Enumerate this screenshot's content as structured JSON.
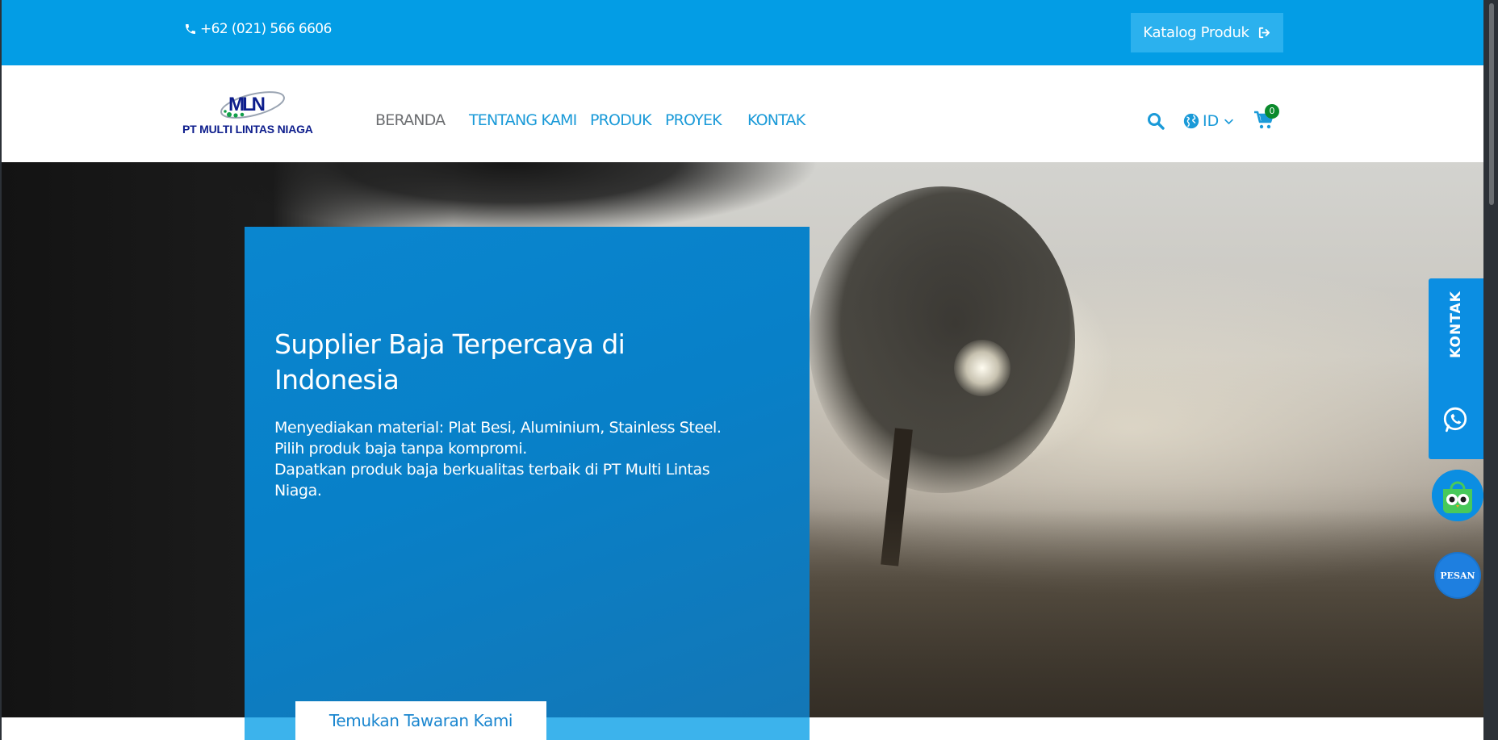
{
  "topbar": {
    "phone": "+62 (021) 566 6606",
    "catalog_label": "Katalog Produk"
  },
  "logo": {
    "mark": "MLN",
    "company_name": "PT MULTI LINTAS NIAGA"
  },
  "nav": {
    "items": [
      {
        "label": "BERANDA",
        "active": true
      },
      {
        "label": "TENTANG KAMI",
        "active": false
      },
      {
        "label": "PRODUK",
        "active": false
      },
      {
        "label": "PROYEK",
        "active": false
      },
      {
        "label": "KONTAK",
        "active": false
      }
    ],
    "language": "ID",
    "cart_count": "0"
  },
  "hero": {
    "title": "Supplier Baja Terpercaya di Indonesia",
    "description_lines": [
      "Menyediakan material: Plat Besi, Aluminium, Stainless Steel.",
      "Pilih produk baja tanpa kompromi.",
      "Dapatkan produk baja berkualitas terbaik di PT Multi Lintas Niaga."
    ],
    "cta_label": "Temukan Tawaran Kami"
  },
  "side_widgets": {
    "kontak_label": "KONTAK",
    "pesan_label": "PESAN"
  },
  "colors": {
    "primary": "#039de5",
    "nav_link": "#1a9ad8",
    "nav_active": "#6d6f72",
    "hero_card": "#0880c8",
    "cart_badge": "#0b8a2c",
    "logo_text": "#0d1d8c"
  },
  "icons": {
    "phone": "phone-icon",
    "catalog": "sign-out-icon",
    "search": "search-icon",
    "language": "globe-icon",
    "chevron": "chevron-down-icon",
    "cart": "cart-icon",
    "whatsapp": "whatsapp-icon",
    "tokopedia": "tokopedia-icon"
  }
}
